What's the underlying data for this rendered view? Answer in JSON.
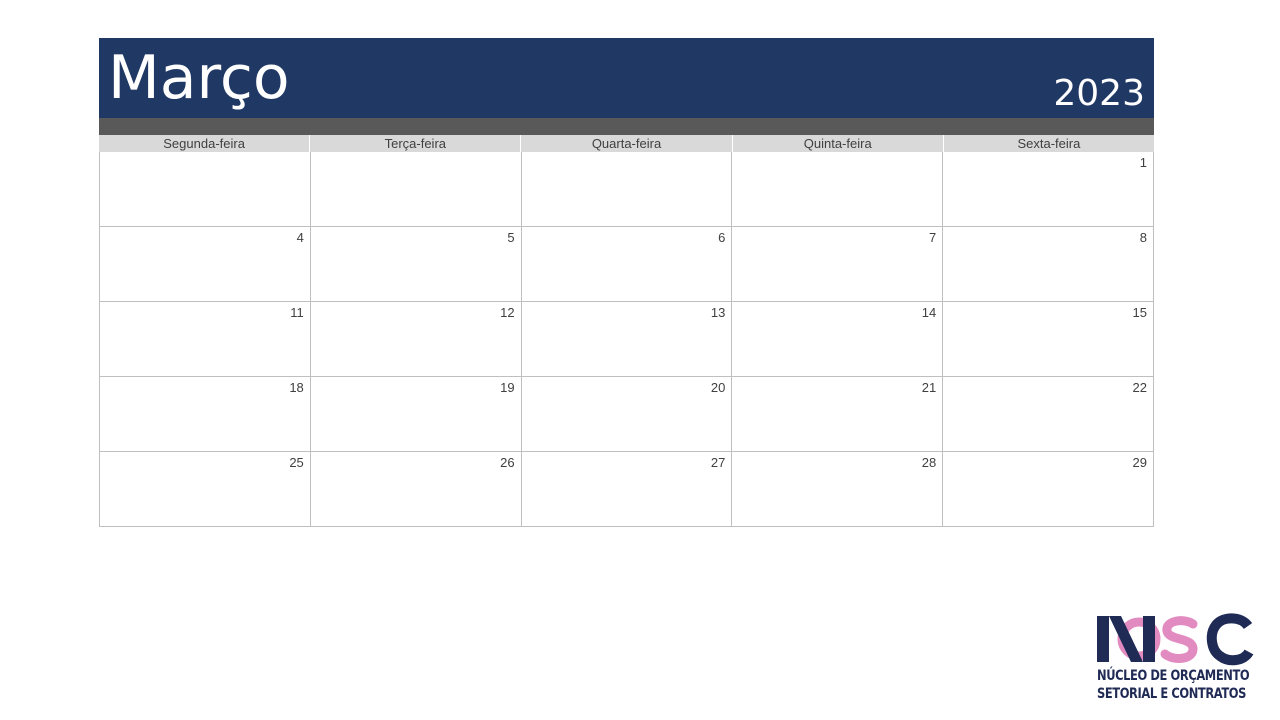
{
  "calendar": {
    "month": "Março",
    "year": "2023",
    "weekdays": [
      "Segunda-feira",
      "Terça-feira",
      "Quarta-feira",
      "Quinta-feira",
      "Sexta-feira"
    ],
    "weeks": [
      [
        "",
        "",
        "",
        "",
        "1"
      ],
      [
        "4",
        "5",
        "6",
        "7",
        "8"
      ],
      [
        "11",
        "12",
        "13",
        "14",
        "15"
      ],
      [
        "18",
        "19",
        "20",
        "21",
        "22"
      ],
      [
        "25",
        "26",
        "27",
        "28",
        "29"
      ]
    ]
  },
  "logo": {
    "line1": "NÚCLEO DE ORÇAMENTO",
    "line2": "SETORIAL E CONTRATOS",
    "colors": {
      "navy": "#1f2a55",
      "pink": "#e28bc0"
    }
  },
  "colors": {
    "header": "#203864",
    "strip": "#595959",
    "weekday_bg": "#d9d9d9"
  }
}
